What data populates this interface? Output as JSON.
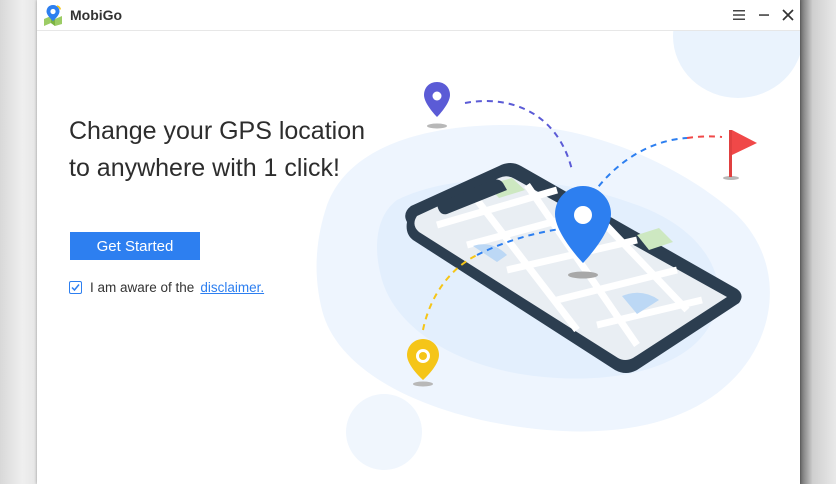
{
  "window": {
    "title": "MobiGo"
  },
  "titlebar_controls": [
    "menu-icon",
    "minimize-icon",
    "close-icon"
  ],
  "main": {
    "headline_line1": "Change your GPS location",
    "headline_line2": "to anywhere with 1 click!",
    "cta_label": "Get Started",
    "agreement_text": "I am aware of the",
    "agreement_link": "disclaimer.",
    "agreement_checked": true
  },
  "illustration_icons": [
    "location-pin-purple-icon",
    "flag-red-icon",
    "location-pin-blue-icon",
    "location-pin-yellow-icon",
    "smartphone-map-icon"
  ],
  "colors": {
    "accent": "#2D7FF0",
    "headline": "#2D2D2D",
    "pin_purple": "#5B5BD6",
    "pin_blue": "#2D7FF0",
    "pin_yellow": "#F5C518",
    "flag_red": "#F04848"
  }
}
